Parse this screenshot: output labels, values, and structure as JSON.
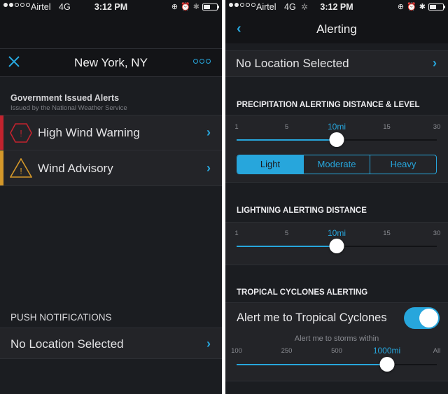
{
  "colors": {
    "accent": "#27a6dc",
    "warning": "#c2232e",
    "advisory": "#d4982a",
    "background": "#1b1d21",
    "row_background": "#232428"
  },
  "status_bar_left": {
    "signal_filled": 2,
    "signal_total": 5,
    "carrier": "Airtel",
    "network": "4G",
    "time": "3:12 PM",
    "icons": [
      "rotation-lock-icon",
      "alarm-icon",
      "bluetooth-icon",
      "battery-icon"
    ]
  },
  "status_bar_right": {
    "signal_filled": 2,
    "signal_total": 5,
    "carrier": "Airtel",
    "network": "4G",
    "activity": "✲",
    "time": "3:12 PM",
    "icons": [
      "rotation-lock-icon",
      "alarm-icon",
      "bluetooth-icon",
      "battery-icon"
    ]
  },
  "left": {
    "nav": {
      "title": "New York, NY",
      "close_icon": "×",
      "more_icon": "more-icon"
    },
    "gov_alerts": {
      "title": "Government Issued Alerts",
      "subtitle": "Issued by the National Weather Service",
      "items": [
        {
          "label": "High Wind Warning",
          "icon": "warning-hexagon-icon",
          "glyph": "!",
          "level": "warning"
        },
        {
          "label": "Wind Advisory",
          "icon": "advisory-triangle-icon",
          "glyph": "!",
          "level": "advisory"
        }
      ]
    },
    "push": {
      "header": "PUSH NOTIFICATIONS",
      "location": "No Location Selected"
    },
    "chevron": "›"
  },
  "right": {
    "nav": {
      "title": "Alerting",
      "back_icon": "‹"
    },
    "location": "No Location Selected",
    "chevron": "›",
    "precipitation": {
      "header": "PRECIPITATION ALERTING DISTANCE & LEVEL",
      "ticks": [
        "1",
        "5",
        "10mi",
        "15",
        "30"
      ],
      "selected_index": 2,
      "levels": [
        "Light",
        "Moderate",
        "Heavy"
      ],
      "selected_level": 0
    },
    "lightning": {
      "header": "LIGHTNING ALERTING DISTANCE",
      "ticks": [
        "1",
        "5",
        "10mi",
        "15",
        "30"
      ],
      "selected_index": 2
    },
    "tropical": {
      "header": "TROPICAL CYCLONES ALERTING",
      "toggle_label": "Alert me to Tropical Cyclones",
      "toggle_on": true,
      "caption": "Alert me to storms within",
      "ticks": [
        "100",
        "250",
        "500",
        "1000mi",
        "All"
      ],
      "selected_index": 3
    }
  }
}
